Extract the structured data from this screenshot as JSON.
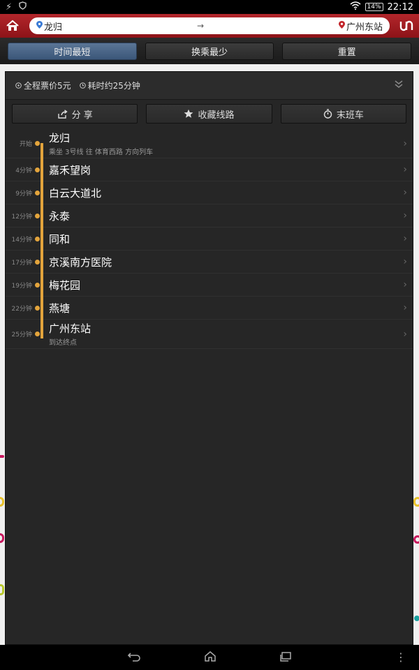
{
  "status": {
    "battery": "14%",
    "time": "22:12"
  },
  "header": {
    "from": "龙归",
    "arrow": "→",
    "to": "广州东站"
  },
  "tabs": [
    "时间最短",
    "换乘最少",
    "重置"
  ],
  "summary": {
    "fare": "全程票价5元",
    "duration": "耗时约25分钟"
  },
  "actions": {
    "share": "分 享",
    "favorite": "收藏线路",
    "last_train": "末班车"
  },
  "stops": [
    {
      "time": "开始",
      "name": "龙归",
      "sub": "乘坐 3号线 往 体育西路 方向列车"
    },
    {
      "time": "4分钟",
      "name": "嘉禾望岗",
      "sub": ""
    },
    {
      "time": "9分钟",
      "name": "白云大道北",
      "sub": ""
    },
    {
      "time": "12分钟",
      "name": "永泰",
      "sub": ""
    },
    {
      "time": "14分钟",
      "name": "同和",
      "sub": ""
    },
    {
      "time": "17分钟",
      "name": "京溪南方医院",
      "sub": ""
    },
    {
      "time": "19分钟",
      "name": "梅花园",
      "sub": ""
    },
    {
      "time": "22分钟",
      "name": "燕塘",
      "sub": ""
    },
    {
      "time": "25分钟",
      "name": "广州东站",
      "sub": "到达终点"
    }
  ],
  "colors": {
    "header_red": "#a01d22",
    "line_orange": "#e3a43c",
    "tab_active": "#4b6789"
  }
}
